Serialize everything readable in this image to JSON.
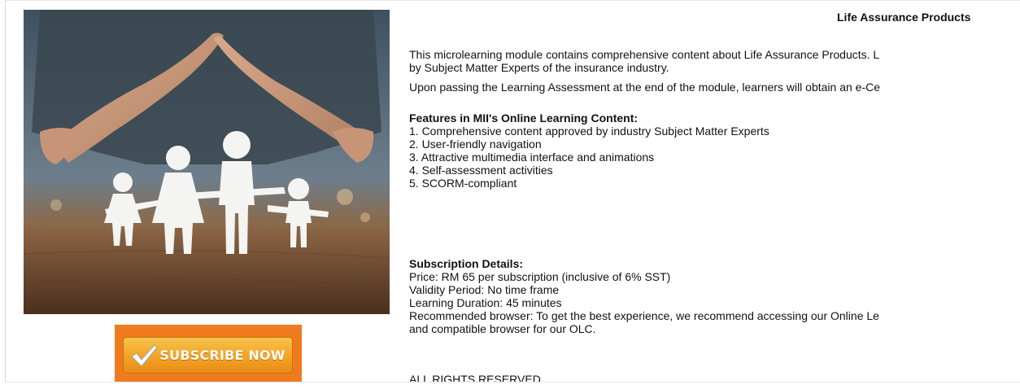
{
  "product": {
    "title": "Life Assurance Products",
    "image_alt": "Hands forming a roof over paper family cut-out"
  },
  "intro": {
    "line1": "This microlearning module contains comprehensive content about Life Assurance Products. L",
    "line2": "by Subject Matter Experts of the insurance industry."
  },
  "certificate_note": "Upon passing the Learning Assessment at the end of the module, learners will obtain an e-Ce",
  "features": {
    "heading": "Features in MII's Online Learning Content:",
    "items": [
      "1. Comprehensive content approved by industry Subject Matter Experts",
      "2. User-friendly navigation",
      "3. Attractive multimedia interface and animations",
      "4. Self-assessment activities",
      "5. SCORM-compliant"
    ]
  },
  "subscription": {
    "heading": "Subscription Details:",
    "price": "Price: RM 65 per subscription (inclusive of 6% SST)",
    "validity": "Validity Period: No time frame",
    "duration": "Learning Duration: 45 minutes",
    "browser_line1": "Recommended browser: To get the best experience, we recommend accessing our Online Le",
    "browser_line2": "and compatible browser for our OLC."
  },
  "rights": "ALL RIGHTS RESERVED",
  "subscribe_button": {
    "label": "SUBSCRIBE NOW",
    "icon": "checkmark-icon"
  },
  "colors": {
    "subscribe_frame": "#f07b1f",
    "subscribe_button": "#f4a82a"
  }
}
